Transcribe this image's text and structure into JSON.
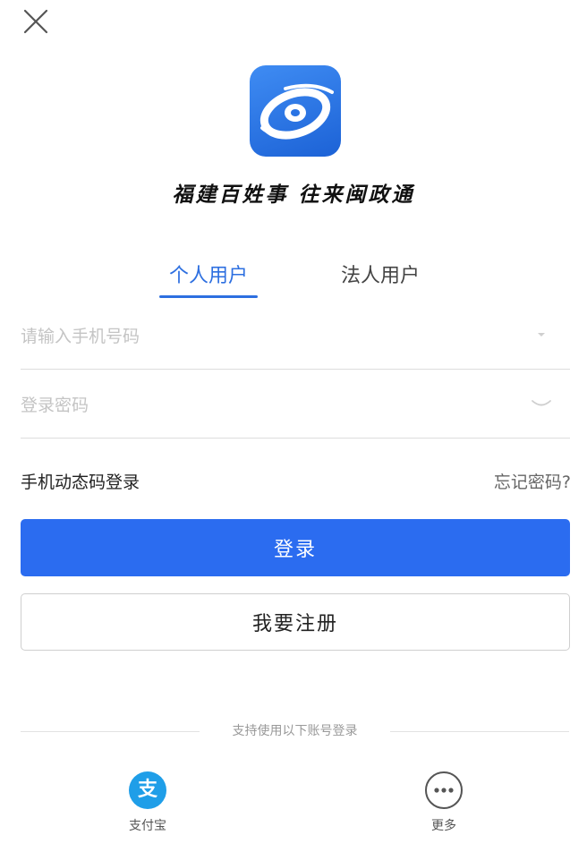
{
  "slogan": "福建百姓事 往来闽政通",
  "tabs": {
    "personal": "个人用户",
    "corporate": "法人用户"
  },
  "form": {
    "phone_placeholder": "请输入手机号码",
    "password_placeholder": "登录密码"
  },
  "links": {
    "sms_login": "手机动态码登录",
    "forgot_password": "忘记密码?"
  },
  "buttons": {
    "login": "登录",
    "register": "我要注册"
  },
  "third_party": {
    "divider_text": "支持使用以下账号登录",
    "alipay_label": "支付宝",
    "alipay_glyph": "支",
    "more_label": "更多"
  },
  "colors": {
    "accent": "#2b6cf0",
    "tab_active": "#2d6fe0",
    "logo": "#1c62d6",
    "alipay": "#1f9ee8"
  },
  "icons": {
    "close": "close-icon",
    "logo": "app-logo-icon",
    "phone_dropdown": "chevron-down-icon",
    "password_toggle": "eye-closed-icon",
    "alipay": "alipay-icon",
    "more": "more-dots-icon"
  }
}
